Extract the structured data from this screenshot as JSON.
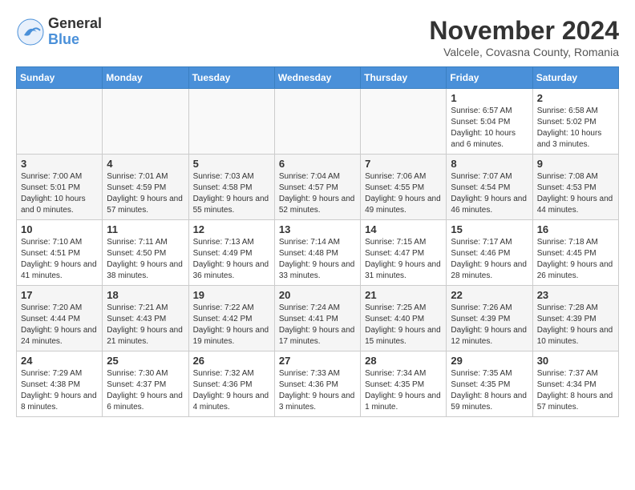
{
  "logo": {
    "general": "General",
    "blue": "Blue"
  },
  "title": "November 2024",
  "subtitle": "Valcele, Covasna County, Romania",
  "days_header": [
    "Sunday",
    "Monday",
    "Tuesday",
    "Wednesday",
    "Thursday",
    "Friday",
    "Saturday"
  ],
  "weeks": [
    [
      {
        "day": "",
        "info": ""
      },
      {
        "day": "",
        "info": ""
      },
      {
        "day": "",
        "info": ""
      },
      {
        "day": "",
        "info": ""
      },
      {
        "day": "",
        "info": ""
      },
      {
        "day": "1",
        "info": "Sunrise: 6:57 AM\nSunset: 5:04 PM\nDaylight: 10 hours and 6 minutes."
      },
      {
        "day": "2",
        "info": "Sunrise: 6:58 AM\nSunset: 5:02 PM\nDaylight: 10 hours and 3 minutes."
      }
    ],
    [
      {
        "day": "3",
        "info": "Sunrise: 7:00 AM\nSunset: 5:01 PM\nDaylight: 10 hours and 0 minutes."
      },
      {
        "day": "4",
        "info": "Sunrise: 7:01 AM\nSunset: 4:59 PM\nDaylight: 9 hours and 57 minutes."
      },
      {
        "day": "5",
        "info": "Sunrise: 7:03 AM\nSunset: 4:58 PM\nDaylight: 9 hours and 55 minutes."
      },
      {
        "day": "6",
        "info": "Sunrise: 7:04 AM\nSunset: 4:57 PM\nDaylight: 9 hours and 52 minutes."
      },
      {
        "day": "7",
        "info": "Sunrise: 7:06 AM\nSunset: 4:55 PM\nDaylight: 9 hours and 49 minutes."
      },
      {
        "day": "8",
        "info": "Sunrise: 7:07 AM\nSunset: 4:54 PM\nDaylight: 9 hours and 46 minutes."
      },
      {
        "day": "9",
        "info": "Sunrise: 7:08 AM\nSunset: 4:53 PM\nDaylight: 9 hours and 44 minutes."
      }
    ],
    [
      {
        "day": "10",
        "info": "Sunrise: 7:10 AM\nSunset: 4:51 PM\nDaylight: 9 hours and 41 minutes."
      },
      {
        "day": "11",
        "info": "Sunrise: 7:11 AM\nSunset: 4:50 PM\nDaylight: 9 hours and 38 minutes."
      },
      {
        "day": "12",
        "info": "Sunrise: 7:13 AM\nSunset: 4:49 PM\nDaylight: 9 hours and 36 minutes."
      },
      {
        "day": "13",
        "info": "Sunrise: 7:14 AM\nSunset: 4:48 PM\nDaylight: 9 hours and 33 minutes."
      },
      {
        "day": "14",
        "info": "Sunrise: 7:15 AM\nSunset: 4:47 PM\nDaylight: 9 hours and 31 minutes."
      },
      {
        "day": "15",
        "info": "Sunrise: 7:17 AM\nSunset: 4:46 PM\nDaylight: 9 hours and 28 minutes."
      },
      {
        "day": "16",
        "info": "Sunrise: 7:18 AM\nSunset: 4:45 PM\nDaylight: 9 hours and 26 minutes."
      }
    ],
    [
      {
        "day": "17",
        "info": "Sunrise: 7:20 AM\nSunset: 4:44 PM\nDaylight: 9 hours and 24 minutes."
      },
      {
        "day": "18",
        "info": "Sunrise: 7:21 AM\nSunset: 4:43 PM\nDaylight: 9 hours and 21 minutes."
      },
      {
        "day": "19",
        "info": "Sunrise: 7:22 AM\nSunset: 4:42 PM\nDaylight: 9 hours and 19 minutes."
      },
      {
        "day": "20",
        "info": "Sunrise: 7:24 AM\nSunset: 4:41 PM\nDaylight: 9 hours and 17 minutes."
      },
      {
        "day": "21",
        "info": "Sunrise: 7:25 AM\nSunset: 4:40 PM\nDaylight: 9 hours and 15 minutes."
      },
      {
        "day": "22",
        "info": "Sunrise: 7:26 AM\nSunset: 4:39 PM\nDaylight: 9 hours and 12 minutes."
      },
      {
        "day": "23",
        "info": "Sunrise: 7:28 AM\nSunset: 4:39 PM\nDaylight: 9 hours and 10 minutes."
      }
    ],
    [
      {
        "day": "24",
        "info": "Sunrise: 7:29 AM\nSunset: 4:38 PM\nDaylight: 9 hours and 8 minutes."
      },
      {
        "day": "25",
        "info": "Sunrise: 7:30 AM\nSunset: 4:37 PM\nDaylight: 9 hours and 6 minutes."
      },
      {
        "day": "26",
        "info": "Sunrise: 7:32 AM\nSunset: 4:36 PM\nDaylight: 9 hours and 4 minutes."
      },
      {
        "day": "27",
        "info": "Sunrise: 7:33 AM\nSunset: 4:36 PM\nDaylight: 9 hours and 3 minutes."
      },
      {
        "day": "28",
        "info": "Sunrise: 7:34 AM\nSunset: 4:35 PM\nDaylight: 9 hours and 1 minute."
      },
      {
        "day": "29",
        "info": "Sunrise: 7:35 AM\nSunset: 4:35 PM\nDaylight: 8 hours and 59 minutes."
      },
      {
        "day": "30",
        "info": "Sunrise: 7:37 AM\nSunset: 4:34 PM\nDaylight: 8 hours and 57 minutes."
      }
    ]
  ]
}
